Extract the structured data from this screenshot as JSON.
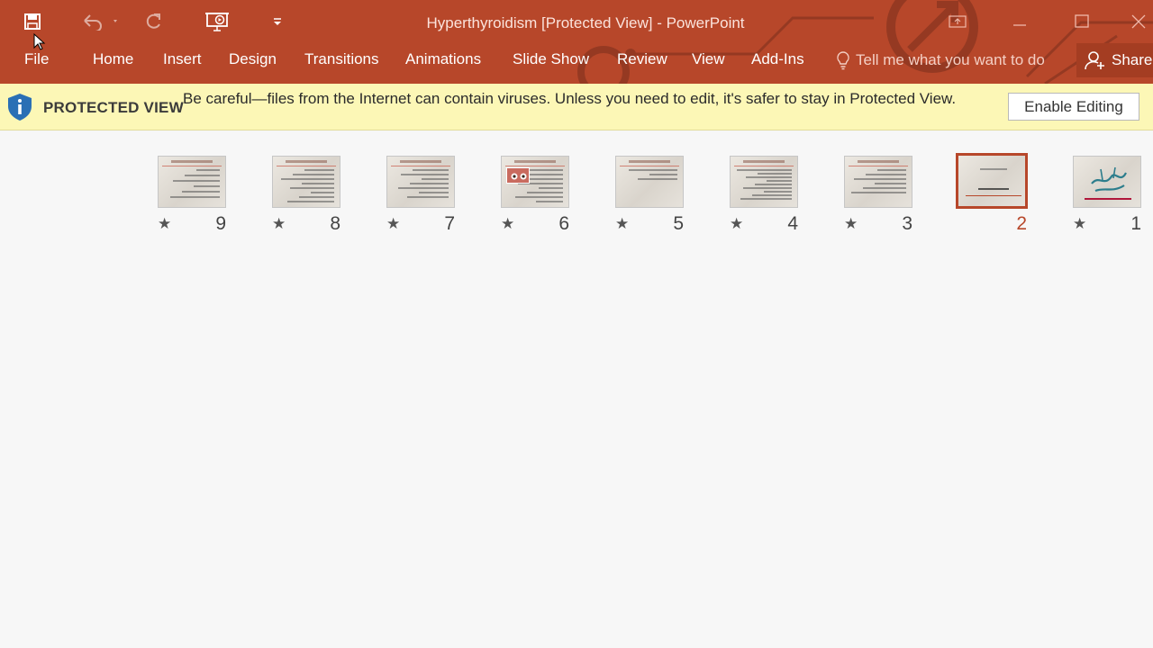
{
  "window": {
    "title": "Hyperthyroidism [Protected View] - PowerPoint"
  },
  "quick_access": [
    {
      "name": "save-icon"
    },
    {
      "name": "undo-icon"
    },
    {
      "name": "redo-icon"
    },
    {
      "name": "start-slideshow-icon"
    },
    {
      "name": "customize-qat-icon"
    }
  ],
  "ribbon": {
    "tabs": [
      "File",
      "Home",
      "Insert",
      "Design",
      "Transitions",
      "Animations",
      "Slide Show",
      "Review",
      "View",
      "Add-Ins"
    ],
    "tell_me": "Tell me what you want to do",
    "share": "Share"
  },
  "protected_view": {
    "title": "PROTECTED VIEW",
    "message": "Be careful—files from the Internet can contain viruses. Unless you need to edit, it's safer to stay in Protected View.",
    "enable_button": "Enable Editing"
  },
  "slides": [
    {
      "number": "9",
      "star": "★",
      "selected": false
    },
    {
      "number": "8",
      "star": "★",
      "selected": false
    },
    {
      "number": "7",
      "star": "★",
      "selected": false
    },
    {
      "number": "6",
      "star": "★",
      "selected": false
    },
    {
      "number": "5",
      "star": "★",
      "selected": false
    },
    {
      "number": "4",
      "star": "★",
      "selected": false
    },
    {
      "number": "3",
      "star": "★",
      "selected": false
    },
    {
      "number": "2",
      "star": "",
      "selected": true
    },
    {
      "number": "1",
      "star": "★",
      "selected": false
    }
  ],
  "colors": {
    "accent": "#b7472a",
    "protected_bar": "#fcf7b6"
  }
}
